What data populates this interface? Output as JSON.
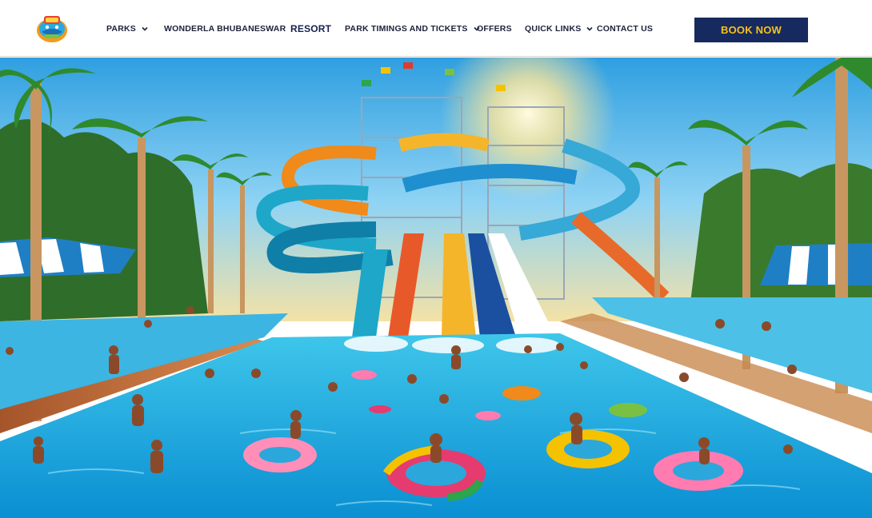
{
  "header": {
    "logo_icon": "aqua-park-logo-icon",
    "nav": [
      {
        "label": "PARKS",
        "has_dropdown": true
      },
      {
        "label": "WONDERLA BHUBANESWAR",
        "has_dropdown": false
      },
      {
        "label": "RESORT",
        "has_dropdown": false,
        "active": true
      },
      {
        "label": "PARK TIMINGS AND TICKETS",
        "has_dropdown": true
      },
      {
        "label": "OFFERS",
        "has_dropdown": false
      },
      {
        "label": "QUICK LINKS",
        "has_dropdown": true
      },
      {
        "label": "CONTACT US",
        "has_dropdown": false
      }
    ],
    "book_now_label": "BOOK NOW"
  },
  "hero": {
    "image": "water-park-slides-pool-illustration"
  },
  "colors": {
    "nav_text": "#1d2138",
    "button_bg": "#172a5f",
    "button_text": "#f6c21a"
  }
}
